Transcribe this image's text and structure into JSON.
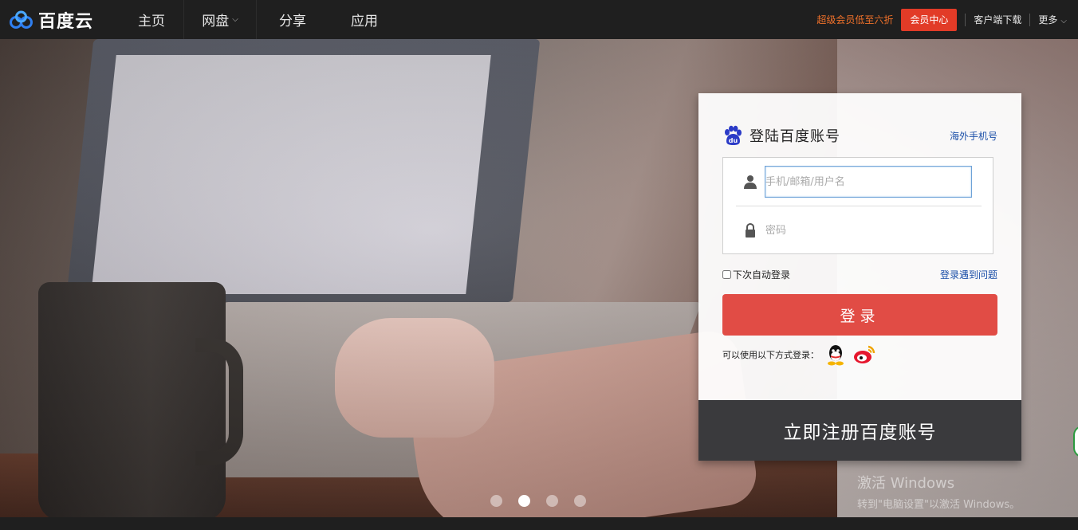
{
  "header": {
    "logo_text": "百度云",
    "nav": [
      {
        "label": "主页"
      },
      {
        "label": "网盘"
      },
      {
        "label": "分享"
      },
      {
        "label": "应用"
      }
    ],
    "promo": "超级会员低至六折",
    "vip_center": "会员中心",
    "client_download": "客户端下载",
    "more": "更多"
  },
  "login": {
    "title": "登陆百度账号",
    "overseas_phone": "海外手机号",
    "username_placeholder": "手机/邮箱/用户名",
    "password_placeholder": "密码",
    "remember_label": "下次自动登录",
    "problem_link": "登录遇到问题",
    "submit_label": "登录",
    "social_prompt": "可以使用以下方式登录：",
    "social_icons": [
      "qq-icon",
      "weibo-icon"
    ],
    "register_label": "立即注册百度账号"
  },
  "carousel": {
    "slide_count": 4,
    "active_index": 1
  },
  "watermark": {
    "line1": "激活 Windows",
    "line2": "转到\"电脑设置\"以激活 Windows。"
  },
  "colors": {
    "topbar": "#1f1f1f",
    "accent_red": "#e14c45",
    "vip_red": "#e23b27",
    "promo_orange": "#f0712a",
    "link_blue": "#1b4fa8",
    "register_bg": "#3a3a3d"
  }
}
